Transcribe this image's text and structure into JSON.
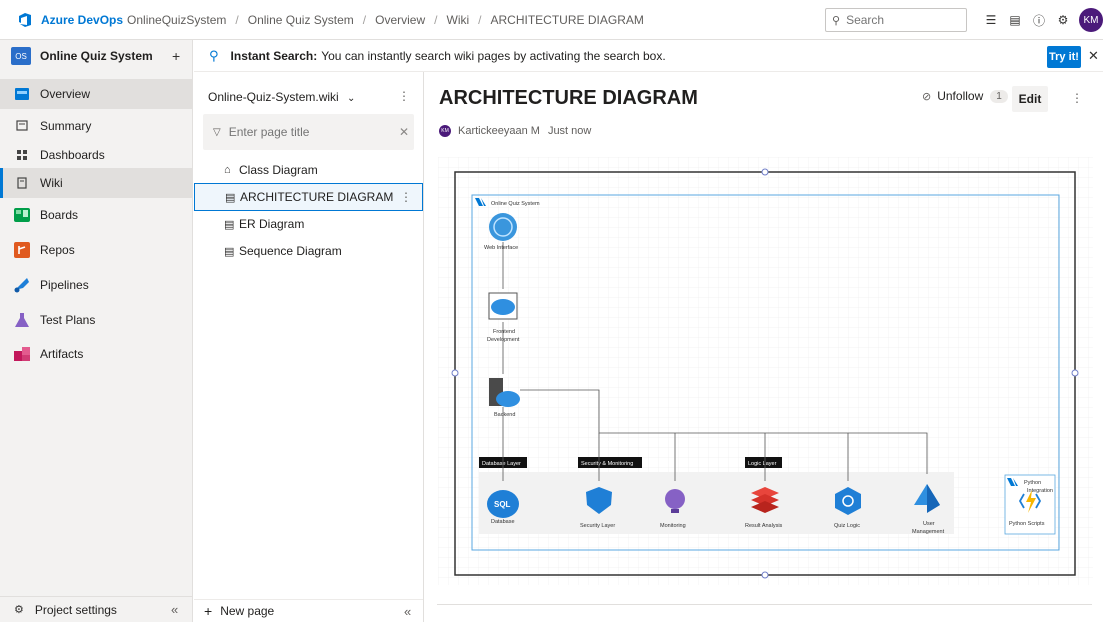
{
  "topbar": {
    "brand": "Azure DevOps",
    "breadcrumb": [
      "OnlineQuizSystem",
      "Online Quiz System",
      "Overview",
      "Wiki",
      "ARCHITECTURE DIAGRAM"
    ],
    "search_placeholder": "Search",
    "avatar_initials": "KM"
  },
  "sidebar": {
    "project_badge": "OS",
    "project_name": "Online Quiz System",
    "items": [
      {
        "label": "Overview",
        "icon": "overview-icon"
      },
      {
        "label": "Summary",
        "icon": "summary-icon"
      },
      {
        "label": "Dashboards",
        "icon": "dashboards-icon"
      },
      {
        "label": "Wiki",
        "icon": "wiki-icon"
      },
      {
        "label": "Boards",
        "icon": "boards-icon"
      },
      {
        "label": "Repos",
        "icon": "repos-icon"
      },
      {
        "label": "Pipelines",
        "icon": "pipelines-icon"
      },
      {
        "label": "Test Plans",
        "icon": "test-plans-icon"
      },
      {
        "label": "Artifacts",
        "icon": "artifacts-icon"
      }
    ],
    "project_settings": "Project settings",
    "collapse_glyph": "«"
  },
  "banner": {
    "title": "Instant Search:",
    "text": "You can instantly search wiki pages by activating the search box.",
    "button": "Try it!",
    "close_glyph": "✕"
  },
  "wiki_tree": {
    "wiki_name": "Online-Quiz-System.wiki",
    "filter_placeholder": "Enter page title",
    "pages": [
      {
        "label": "Class Diagram",
        "icon": "home-icon"
      },
      {
        "label": "ARCHITECTURE DIAGRAM",
        "icon": "page-icon"
      },
      {
        "label": "ER Diagram",
        "icon": "page-icon"
      },
      {
        "label": "Sequence Diagram",
        "icon": "page-icon"
      }
    ],
    "new_page": "New page",
    "collapse_glyph": "«"
  },
  "content": {
    "page_title": "ARCHITECTURE DIAGRAM",
    "unfollow_label": "Unfollow",
    "follower_count": "1",
    "edit_label": "Edit",
    "author_initials": "KM",
    "author": "Kartickeeyaan M",
    "modified": "Just now"
  },
  "diagram": {
    "group_title": "Online Quiz System",
    "nodes": {
      "web": "Web Interface",
      "frontend_line1": "Frontend",
      "frontend_line2": "Development",
      "backend": "Backend",
      "database": "Database",
      "security": "Security Layer",
      "monitoring": "Monitoring",
      "result": "Result Analysis",
      "quiz": "Quiz Logic",
      "user_line1": "User",
      "user_line2": "Management",
      "python_scripts": "Python Scripts",
      "python_group_line1": "Python",
      "python_group_line2": "Integration"
    },
    "sql_icon_text": "SQL",
    "layers": {
      "database": "Database Layer",
      "security": "Security & Monitoring",
      "logic": "Logic Layer"
    },
    "colors": {
      "azure_blue": "#0078d4",
      "group_border": "#5aa7e0",
      "outer_border": "#333333",
      "layer_band": "#f2f2f2"
    }
  }
}
